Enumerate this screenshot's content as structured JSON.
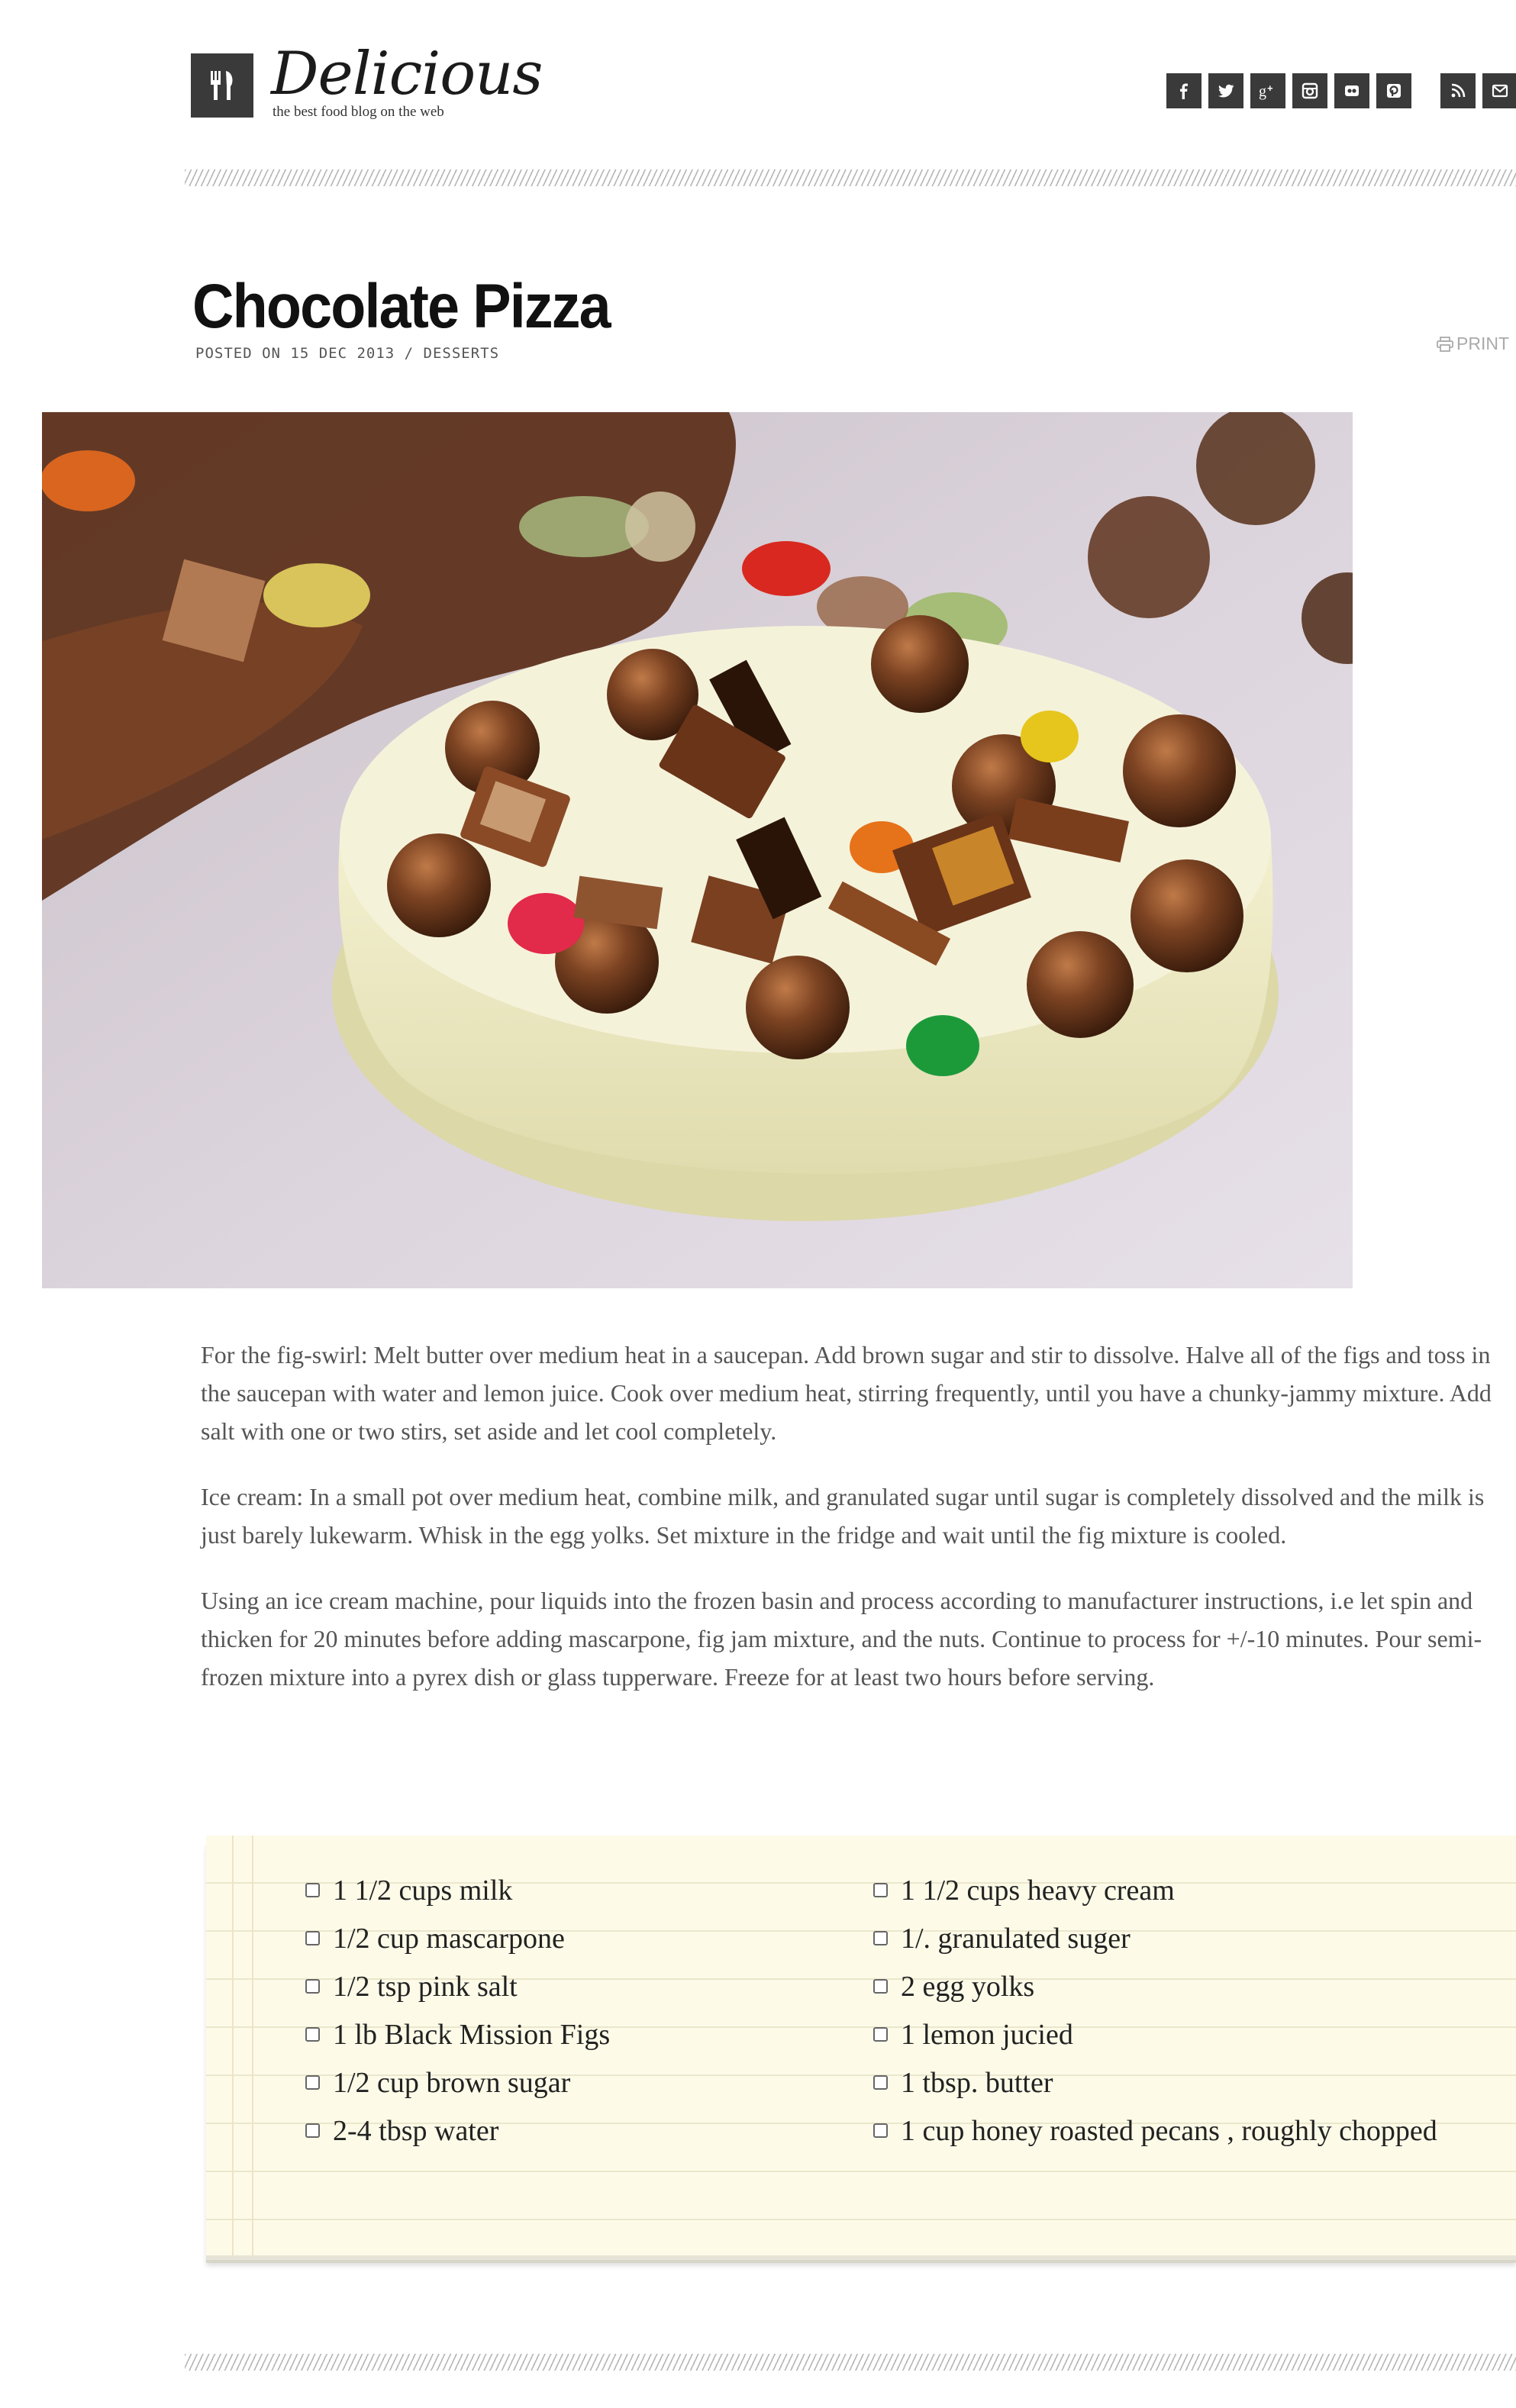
{
  "header": {
    "site_name": "Delicious",
    "tagline": "the best food blog on the web",
    "social": [
      {
        "icon": "facebook-icon"
      },
      {
        "icon": "twitter-icon"
      },
      {
        "icon": "google-plus-icon"
      },
      {
        "icon": "instagram-icon"
      },
      {
        "icon": "flickr-icon"
      },
      {
        "icon": "pinterest-icon"
      },
      {
        "icon": "rss-icon"
      },
      {
        "icon": "email-icon"
      }
    ]
  },
  "post": {
    "title": "Chocolate Pizza",
    "meta": "POSTED ON 15 DEC 2013 / DESSERTS",
    "print_label": "PRINT",
    "paragraphs": [
      "For the fig-swirl: Melt butter over medium heat in a saucepan. Add brown sugar and stir to dissolve. Halve all of the figs and toss in the saucepan with water and lemon juice. Cook over medium heat, stirring frequently, until you have a chunky-jammy mixture. Add salt with one or two stirs, set aside and let cool completely.",
      "Ice cream: In a small pot over medium heat, combine milk, and granulated sugar until sugar is completely dissolved and the milk is just barely lukewarm. Whisk in the egg yolks. Set mixture in the fridge and wait until the fig mixture is cooled.",
      "Using an ice cream machine, pour liquids into the frozen basin and process according to manufacturer instructions, i.e let spin and thicken for 20 minutes before adding mascarpone, fig jam mixture, and the nuts. Continue to process for +/-10 minutes. Pour semi-frozen mixture into a pyrex dish or glass tupperware. Freeze for at least two hours before serving."
    ]
  },
  "ingredients": {
    "left": [
      "1 1/2 cups milk",
      "1/2 cup mascarpone",
      "1/2 tsp pink salt",
      "1 lb Black Mission Figs",
      "1/2 cup brown sugar",
      "2-4 tbsp water"
    ],
    "right": [
      "1 1/2 cups heavy cream",
      "1/. granulated suger",
      "2 egg yolks",
      "1 lemon jucied",
      "1 tbsp. butter",
      "1 cup honey roasted pecans , roughly chopped"
    ]
  },
  "colors": {
    "header_dark": "#3a3a3a",
    "recipe_card_bg": "#fdfbe8",
    "body_text": "#555555"
  }
}
